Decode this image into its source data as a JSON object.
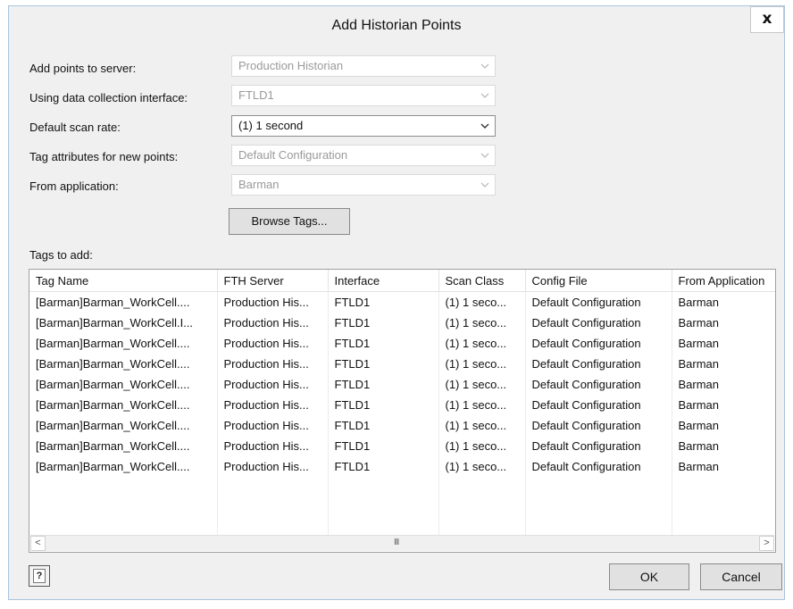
{
  "window": {
    "title": "Add Historian Points",
    "close_label": "x"
  },
  "form": {
    "server": {
      "label": "Add points to server:",
      "value": "Production Historian"
    },
    "interface": {
      "label": "Using data collection interface:",
      "value": "FTLD1"
    },
    "scan_rate": {
      "label": "Default scan rate:",
      "value": "(1) 1 second"
    },
    "tag_attributes": {
      "label": "Tag attributes for new points:",
      "value": "Default Configuration"
    },
    "application": {
      "label": "From application:",
      "value": "Barman"
    },
    "browse_label": "Browse Tags..."
  },
  "tags": {
    "label": "Tags to add:",
    "columns": [
      "Tag Name",
      "FTH Server",
      "Interface",
      "Scan Class",
      "Config File",
      "From Application"
    ],
    "rows": [
      [
        "[Barman]Barman_WorkCell....",
        "Production His...",
        "FTLD1",
        "(1) 1 seco...",
        "Default Configuration",
        "Barman"
      ],
      [
        "[Barman]Barman_WorkCell.I...",
        "Production His...",
        "FTLD1",
        "(1) 1 seco...",
        "Default Configuration",
        "Barman"
      ],
      [
        "[Barman]Barman_WorkCell....",
        "Production His...",
        "FTLD1",
        "(1) 1 seco...",
        "Default Configuration",
        "Barman"
      ],
      [
        "[Barman]Barman_WorkCell....",
        "Production His...",
        "FTLD1",
        "(1) 1 seco...",
        "Default Configuration",
        "Barman"
      ],
      [
        "[Barman]Barman_WorkCell....",
        "Production His...",
        "FTLD1",
        "(1) 1 seco...",
        "Default Configuration",
        "Barman"
      ],
      [
        "[Barman]Barman_WorkCell....",
        "Production His...",
        "FTLD1",
        "(1) 1 seco...",
        "Default Configuration",
        "Barman"
      ],
      [
        "[Barman]Barman_WorkCell....",
        "Production His...",
        "FTLD1",
        "(1) 1 seco...",
        "Default Configuration",
        "Barman"
      ],
      [
        "[Barman]Barman_WorkCell....",
        "Production His...",
        "FTLD1",
        "(1) 1 seco...",
        "Default Configuration",
        "Barman"
      ],
      [
        "[Barman]Barman_WorkCell....",
        "Production His...",
        "FTLD1",
        "(1) 1 seco...",
        "Default Configuration",
        "Barman"
      ]
    ],
    "scroll_left": "<",
    "scroll_right": ">",
    "scroll_grip": "III"
  },
  "footer": {
    "help_label": "?",
    "ok_label": "OK",
    "cancel_label": "Cancel"
  },
  "colors": {
    "window_bg": "#f0f0f0",
    "border": "#a9c4e0",
    "disabled_text": "#9a9a9a"
  },
  "icons": {
    "close": "close-icon",
    "dropdown": "chevron-down-icon",
    "help": "help-icon"
  }
}
